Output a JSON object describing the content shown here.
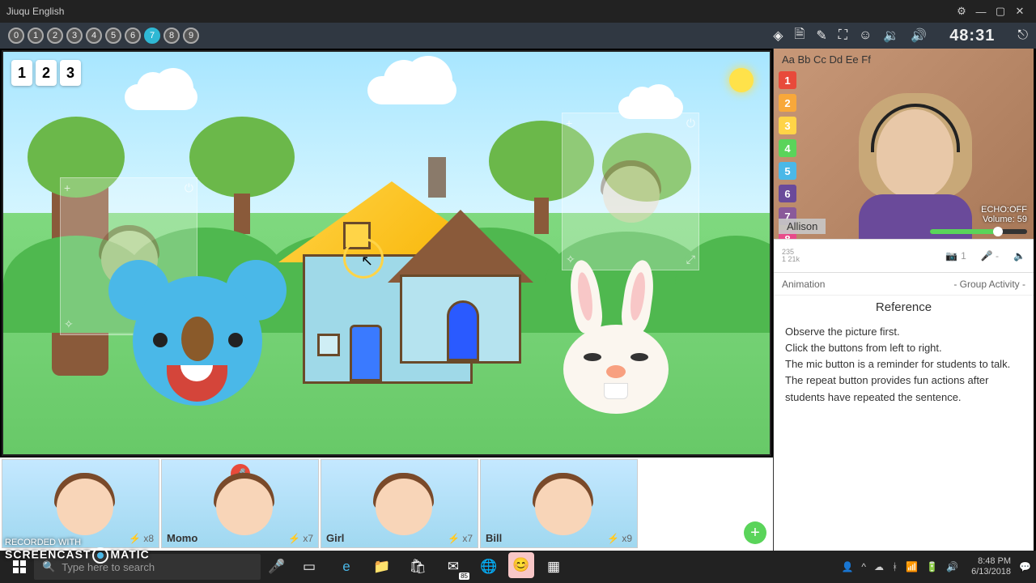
{
  "app_title": "Jiuqu English",
  "steps": [
    "0",
    "1",
    "2",
    "3",
    "4",
    "5",
    "6",
    "7",
    "8",
    "9"
  ],
  "active_step": 7,
  "timer": "48:31",
  "stage_buttons": [
    "1",
    "2",
    "3"
  ],
  "teacher": {
    "name": "Allison",
    "echo": "ECHO:OFF",
    "volume_label": "Volume: 59",
    "wall_letters": "Aa  Bb  Cc  Dd  Ee  Ff",
    "cam_count": "1"
  },
  "controls": {
    "stat1": "235",
    "stat2": "1 21k"
  },
  "tabs": {
    "left": "Animation",
    "right": "- Group Activity -"
  },
  "reference": {
    "title": "Reference",
    "lines": [
      "Observe the picture first.",
      "Click the buttons from left to right.",
      "The mic button is a reminder for students to talk.",
      "The repeat button provides fun actions after students have repeated the sentence."
    ]
  },
  "students": [
    {
      "name": "",
      "score": "x8",
      "muted": false
    },
    {
      "name": "Momo",
      "score": "x7",
      "muted": true
    },
    {
      "name": "Girl",
      "score": "x7",
      "muted": false
    },
    {
      "name": "Bill",
      "score": "x9",
      "muted": false
    }
  ],
  "watermark": {
    "line1": "RECORDED WITH",
    "line2a": "SCREENCAST",
    "line2b": "MATIC"
  },
  "taskbar": {
    "search_placeholder": "Type here to search",
    "mail_badge": "85",
    "time": "8:48 PM",
    "date": "6/13/2018"
  }
}
